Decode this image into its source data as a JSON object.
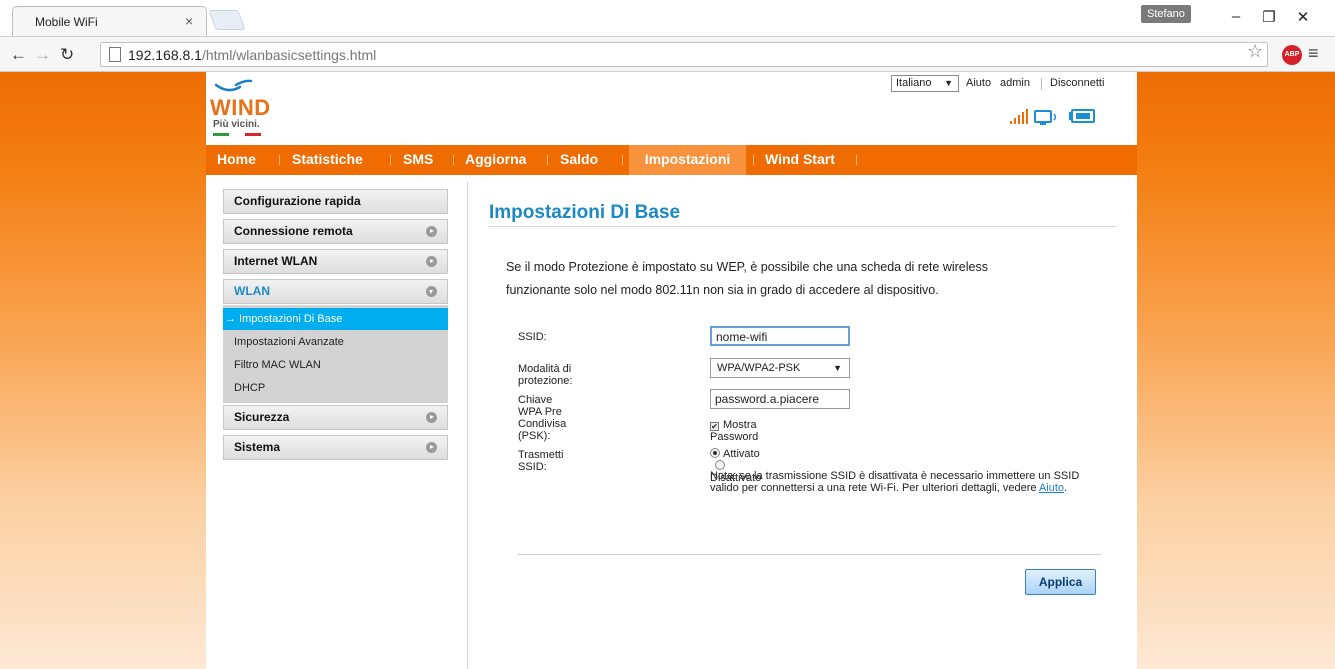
{
  "browser": {
    "tab_title": "Mobile WiFi",
    "tab_close": "×",
    "profile_name": "Stefano",
    "url_host": "192.168.8.1",
    "url_path": "/html/wlanbasicsettings.html",
    "extension_label": "ABP"
  },
  "header": {
    "brand_name": "WIND",
    "brand_tagline": "Più vicini.",
    "language": "Italiano",
    "links": [
      "Aiuto",
      "admin",
      "Disconnetti"
    ]
  },
  "main_nav": [
    "Home",
    "Statistiche",
    "SMS",
    "Aggiorna",
    "Saldo",
    "Impostazioni",
    "Wind Start"
  ],
  "main_nav_active": "Impostazioni",
  "sidebar": {
    "sections": [
      "Configurazione rapida",
      "Connessione remota",
      "Internet WLAN",
      "WLAN",
      "Sicurezza",
      "Sistema"
    ],
    "wlan_items": [
      "→ Impostazioni Di Base",
      "Impostazioni Avanzate",
      "Filtro MAC WLAN",
      "DHCP"
    ]
  },
  "content": {
    "title": "Impostazioni Di Base",
    "info_line1": "Se il modo Protezione è impostato su WEP, è possibile che una scheda di rete wireless",
    "info_line2": "funzionante solo nel modo 802.11n non sia in grado di accedere al dispositivo.",
    "fields": {
      "ssid_label": "SSID:",
      "ssid_value": "nome-wifi",
      "security_label": "Modalità di protezione:",
      "security_value": "WPA/WPA2-PSK",
      "psk_label": "Chiave WPA Pre Condivisa (PSK):",
      "psk_value": "password.a.piacere",
      "show_password_label": "Mostra Password",
      "broadcast_label": "Trasmetti SSID:",
      "broadcast_on": "Attivato",
      "broadcast_off": "Disattivato"
    },
    "note_text": "Nota: se la trasmissione SSID è disattivata è necessario immettere un SSID valido per connettersi a una rete Wi-Fi. Per ulteriori dettagli, vedere ",
    "note_link": "Aiuto",
    "note_end": ".",
    "apply_label": "Applica"
  },
  "colors": {
    "brand_orange": "#ef6c03",
    "title_blue": "#1c89c7",
    "active_blue": "#00aeef"
  }
}
